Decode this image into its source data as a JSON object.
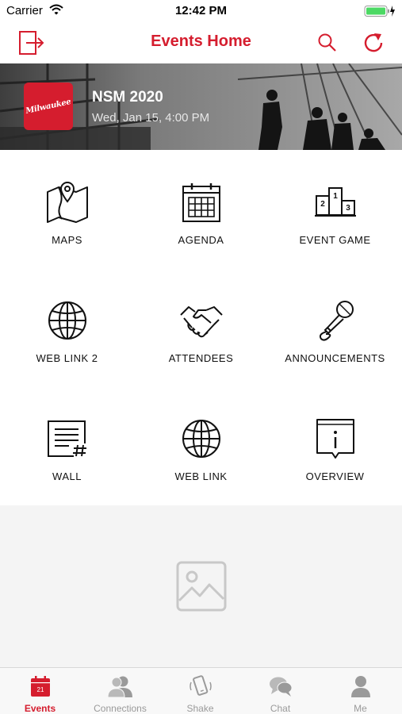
{
  "status_bar": {
    "carrier": "Carrier",
    "time": "12:42 PM"
  },
  "nav": {
    "title": "Events Home",
    "accent_color": "#d51d2e"
  },
  "event": {
    "logo_text": "Milwaukee",
    "name": "NSM 2020",
    "date": "Wed, Jan 15, 4:00 PM"
  },
  "tiles": [
    {
      "label": "MAPS",
      "icon": "map-pin-icon"
    },
    {
      "label": "AGENDA",
      "icon": "calendar-icon"
    },
    {
      "label": "EVENT GAME",
      "icon": "podium-icon"
    },
    {
      "label": "WEB LINK 2",
      "icon": "globe-icon"
    },
    {
      "label": "ATTENDEES",
      "icon": "handshake-icon"
    },
    {
      "label": "ANNOUNCEMENTS",
      "icon": "microphone-icon"
    },
    {
      "label": "WALL",
      "icon": "document-hash-icon"
    },
    {
      "label": "WEB LINK",
      "icon": "globe-icon"
    },
    {
      "label": "OVERVIEW",
      "icon": "info-icon"
    }
  ],
  "podium_numbers": [
    "1",
    "2",
    "3"
  ],
  "calendar_day": "21",
  "tabs": [
    {
      "label": "Events",
      "icon": "calendar-icon",
      "active": true
    },
    {
      "label": "Connections",
      "icon": "people-icon",
      "active": false
    },
    {
      "label": "Shake",
      "icon": "shake-phone-icon",
      "active": false
    },
    {
      "label": "Chat",
      "icon": "chat-bubbles-icon",
      "active": false
    },
    {
      "label": "Me",
      "icon": "person-icon",
      "active": false
    }
  ]
}
